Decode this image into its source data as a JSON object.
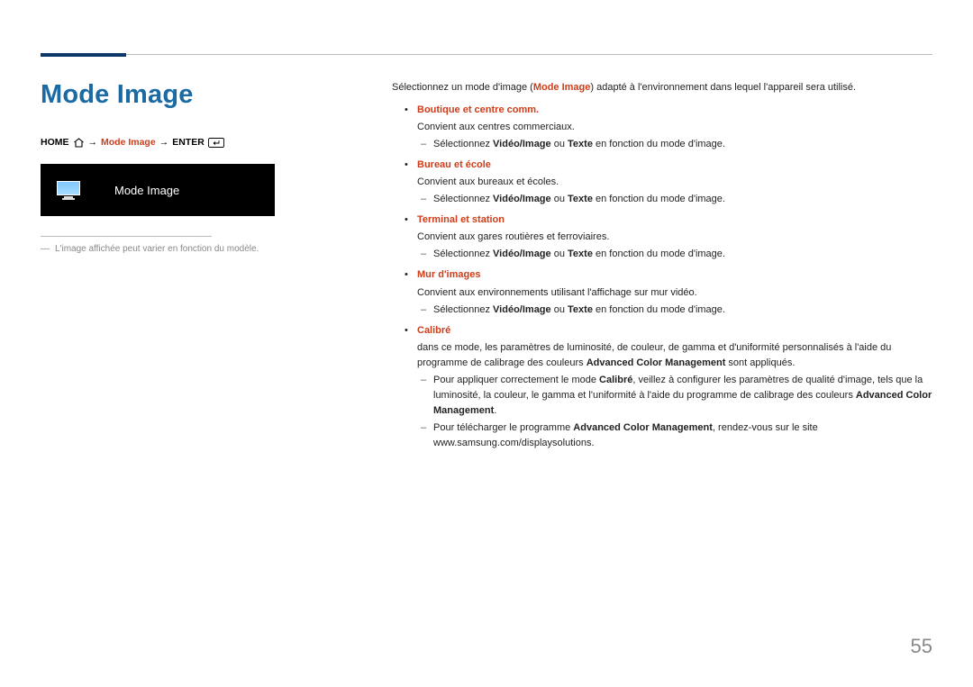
{
  "page_number": "55",
  "title": "Mode Image",
  "breadcrumb": {
    "home": "HOME",
    "arrow1": "→",
    "mode": "Mode Image",
    "arrow2": "→",
    "enter": "ENTER"
  },
  "preview": {
    "label": "Mode Image"
  },
  "note_prefix": "―",
  "note": "L'image affichée peut varier en fonction du modèle.",
  "intro_pre": "Sélectionnez un mode d'image (",
  "intro_mode": "Mode Image",
  "intro_post": ") adapté à l'environnement dans lequel l'appareil sera utilisé.",
  "sel_pre": "Sélectionnez ",
  "sel_vi": "Vidéo/Image",
  "sel_or": " ou ",
  "sel_tx": "Texte",
  "sel_post": " en fonction du mode d'image.",
  "modes": [
    {
      "title": "Boutique et centre comm.",
      "desc": "Convient aux centres commerciaux.",
      "has_select": true
    },
    {
      "title": "Bureau et école",
      "desc": "Convient aux bureaux et écoles.",
      "has_select": true
    },
    {
      "title": "Terminal et station",
      "desc": "Convient aux gares routières et ferroviaires.",
      "has_select": true
    },
    {
      "title": "Mur d'images",
      "desc": "Convient aux environnements utilisant l'affichage sur mur vidéo.",
      "has_select": true
    }
  ],
  "calibre": {
    "title": "Calibré",
    "desc_pre": "dans ce mode, les paramètres de luminosité, de couleur, de gamma et d'uniformité personnalisés à l'aide du programme de calibrage des couleurs ",
    "desc_acm": "Advanced Color Management",
    "desc_post": " sont appliqués.",
    "sub1_pre": "Pour appliquer correctement le mode ",
    "sub1_cal": "Calibré",
    "sub1_mid": ", veillez à configurer les paramètres de qualité d'image, tels que la luminosité, la couleur, le gamma et l'uniformité à l'aide du programme de calibrage des couleurs ",
    "sub1_acm": "Advanced Color Management",
    "sub1_post": ".",
    "sub2_pre": "Pour télécharger le programme ",
    "sub2_acm": "Advanced Color Management",
    "sub2_post": ", rendez-vous sur le site www.samsung.com/displaysolutions."
  }
}
